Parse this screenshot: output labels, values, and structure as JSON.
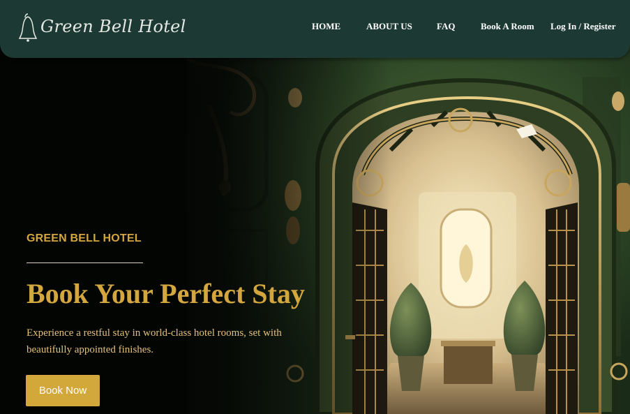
{
  "brand": {
    "name": "Green Bell Hotel",
    "logo_icon": "bell-icon"
  },
  "nav": {
    "items": [
      {
        "label": "HOME"
      },
      {
        "label": "ABOUT US"
      },
      {
        "label": "FAQ"
      },
      {
        "label": "Book A Room"
      },
      {
        "label": "Log In / Register"
      }
    ]
  },
  "hero": {
    "eyebrow": "GREEN BELL HOTEL",
    "title": "Book Your Perfect Stay",
    "description": "Experience a restful stay in world-class hotel rooms, set with beautifully appointed finishes.",
    "cta_label": "Book Now",
    "image_subject": "ornate green hotel corridor with an arched gold doorway"
  },
  "colors": {
    "header_bg": "#1c3a33",
    "accent_gold": "#d4a73e",
    "button_bg": "#d3a83a",
    "hero_wall_green": "#2d4626"
  }
}
